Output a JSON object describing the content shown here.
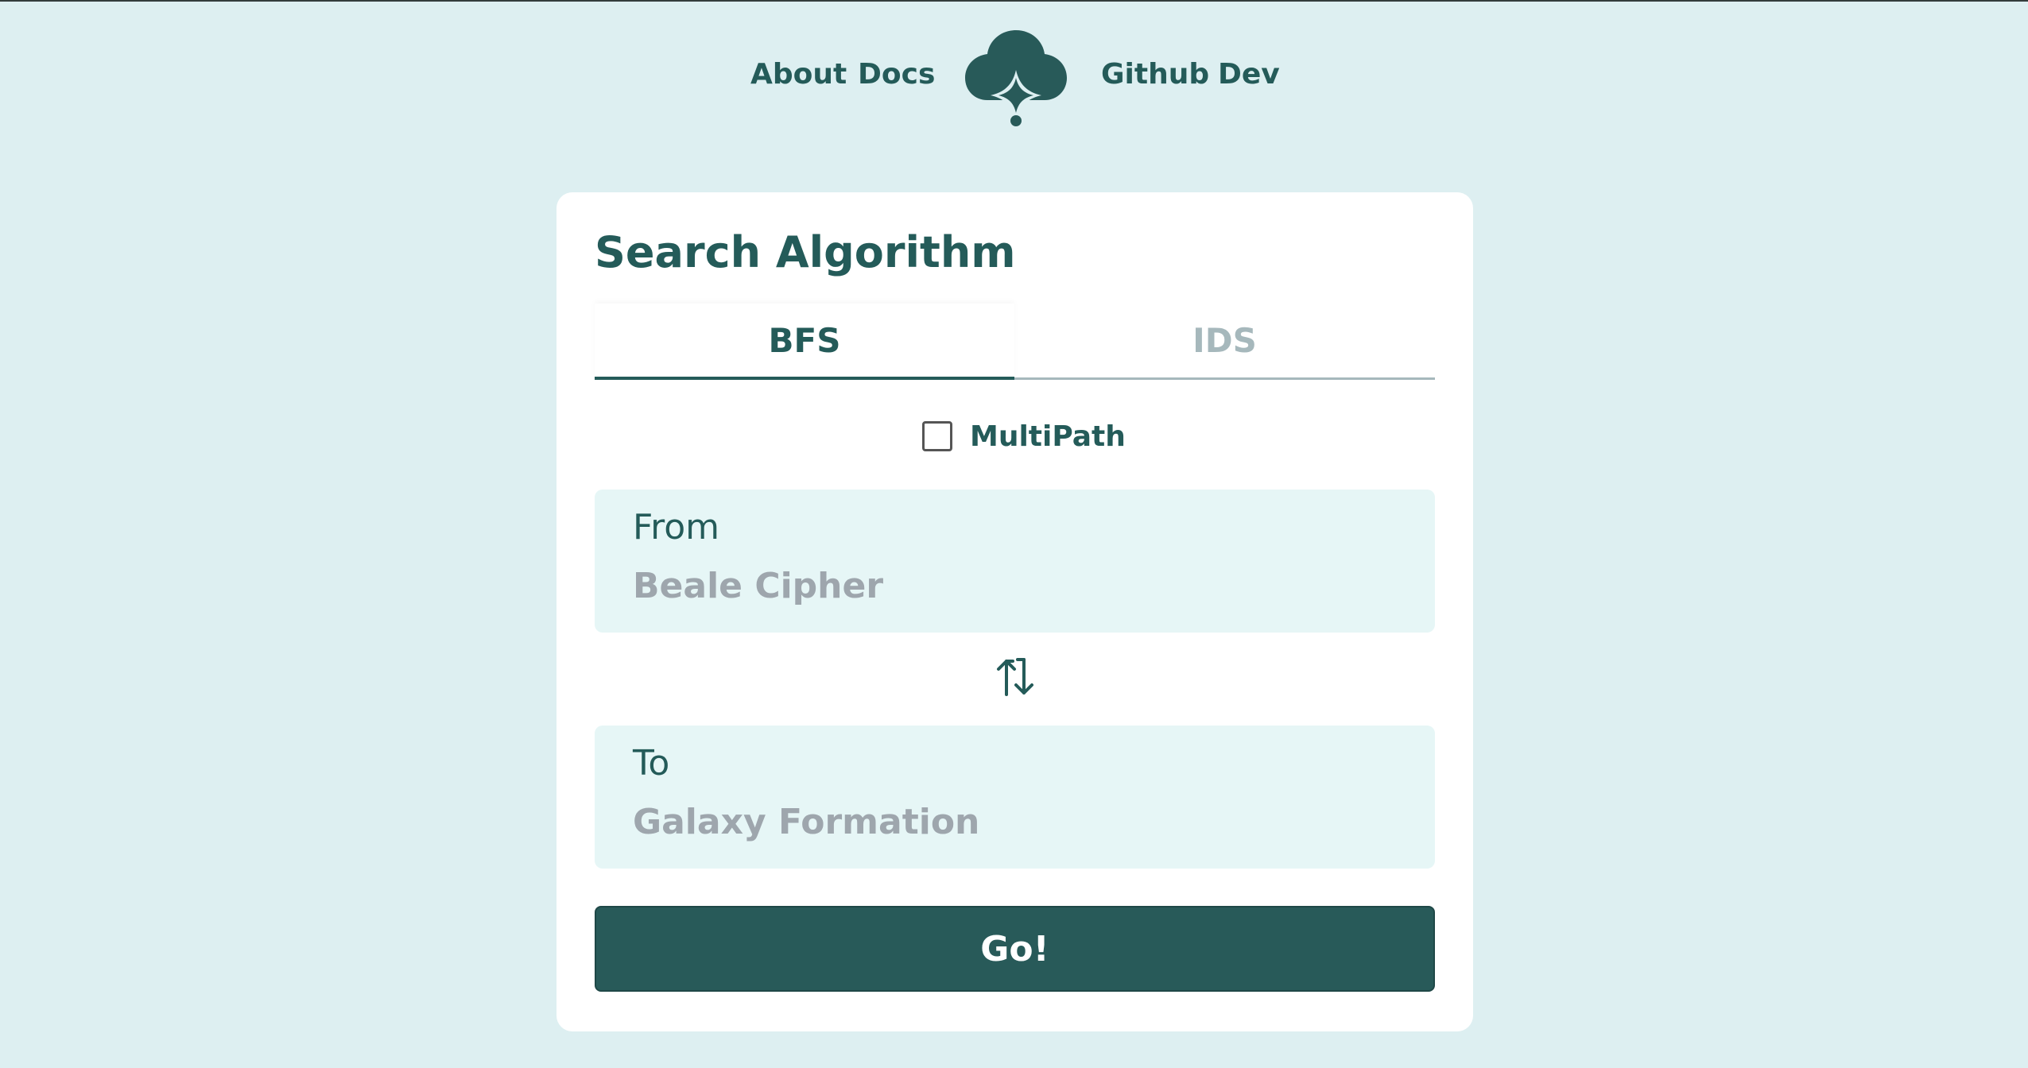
{
  "nav": {
    "links": [
      "About",
      "Docs",
      "Github",
      "Dev"
    ],
    "logo_icon": "cloud-sparkle-icon"
  },
  "card": {
    "title": "Search Algorithm",
    "tabs": [
      {
        "label": "BFS",
        "active": true
      },
      {
        "label": "IDS",
        "active": false
      }
    ],
    "multipath": {
      "label": "MultiPath",
      "checked": false
    },
    "from": {
      "label": "From",
      "value": "",
      "placeholder": "Beale Cipher"
    },
    "to": {
      "label": "To",
      "value": "",
      "placeholder": "Galaxy Formation"
    },
    "swap_icon": "swap-vertical-arrows-icon",
    "go_label": "Go!"
  },
  "colors": {
    "background": "#ddeff1",
    "card": "#ffffff",
    "primary": "#285a59",
    "field_bg": "#e6f6f6",
    "inactive_tab": "#a6b8bc",
    "placeholder": "#9ea6ad"
  }
}
